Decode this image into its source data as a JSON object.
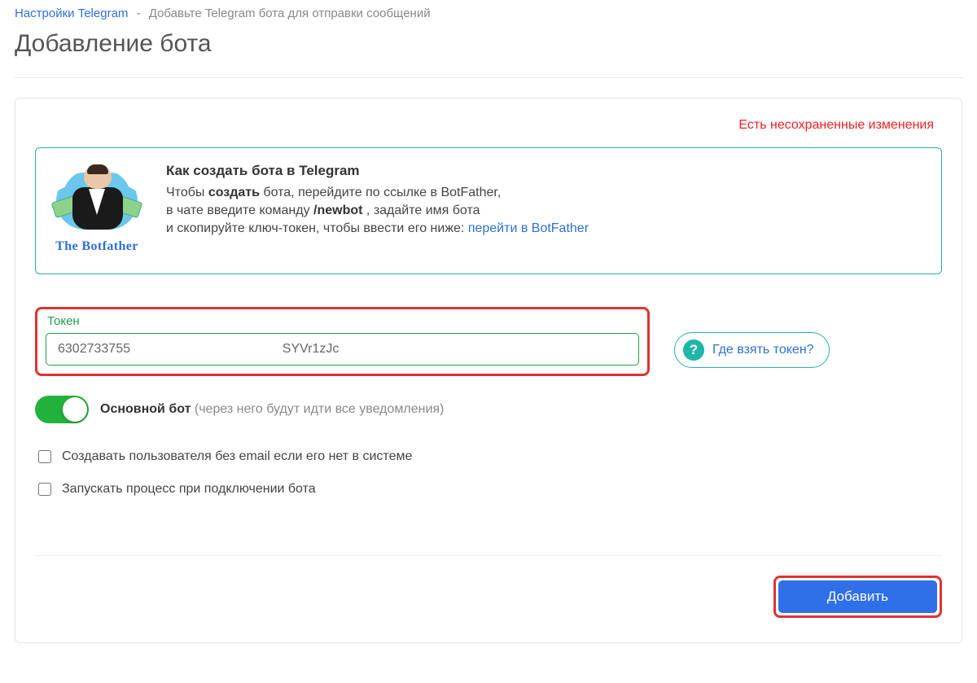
{
  "breadcrumb": {
    "link": "Настройки Telegram",
    "current": "Добавьте Telegram бота для отправки сообщений"
  },
  "page_title": "Добавление бота",
  "unsaved_warning": "Есть несохраненные изменения",
  "help": {
    "caption": "The Botfather",
    "title": "Как создать бота в Telegram",
    "line1_a": "Чтобы ",
    "line1_b": "создать",
    "line1_c": " бота, перейдите по ссылке в BotFather,",
    "line2_a": "в чате введите команду ",
    "line2_b": "/newbot",
    "line2_c": " , задайте имя бота",
    "line3_a": "и скопируйте ключ-токен, чтобы ввести его ниже: ",
    "line3_link": "перейти в BotFather"
  },
  "token": {
    "label": "Токен",
    "value": "6302733755                                          SYVr1zJc",
    "help_button": "Где взять токен?"
  },
  "main_bot": {
    "bold": "Основной бот",
    "note": " (через него будут идти все уведомления)"
  },
  "cb_create_user": "Создавать пользователя без email если его нет в системе",
  "cb_start_process": "Запускать процесс при подключении бота",
  "submit": "Добавить"
}
